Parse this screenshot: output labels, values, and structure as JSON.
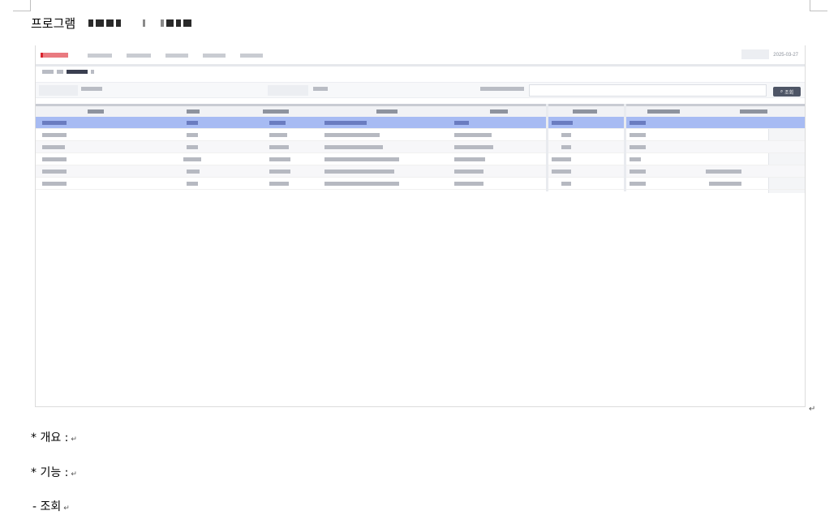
{
  "document": {
    "heading_prefix": "프로그램",
    "screenshot_date": "2025-03-27",
    "search_button_label": "조회",
    "search_button_icon": "search-icon",
    "paragraph_mark": "↵",
    "lines": [
      {
        "text": "* 개요 :"
      },
      {
        "text": "* 기능 :"
      },
      {
        "text": " - 조회"
      }
    ]
  },
  "colors": {
    "selected_row": "#a7bbf3",
    "search_button": "#4e5566",
    "logo_accent": "#d9232e"
  }
}
